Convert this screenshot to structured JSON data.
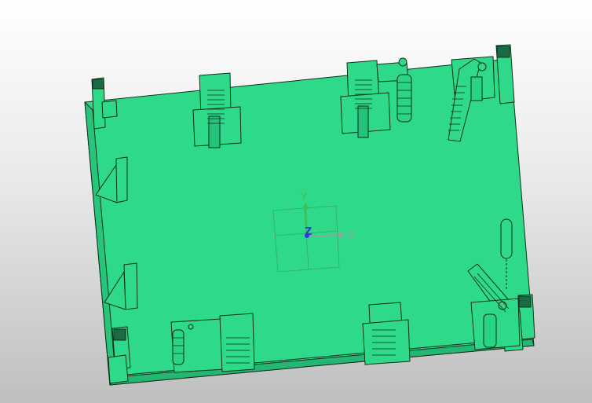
{
  "viewport": {
    "background_top": "#ffffff",
    "background_bottom": "#bfbfbf"
  },
  "model": {
    "body_color": "#2fd98a",
    "edge_color": "#0f2f1a"
  },
  "triad": {
    "x_label": "X",
    "y_label": "Y",
    "z_label": "Z",
    "x_color": "#8aa89a",
    "y_color": "#3fbf4f",
    "z_color": "#2a3fd8"
  }
}
